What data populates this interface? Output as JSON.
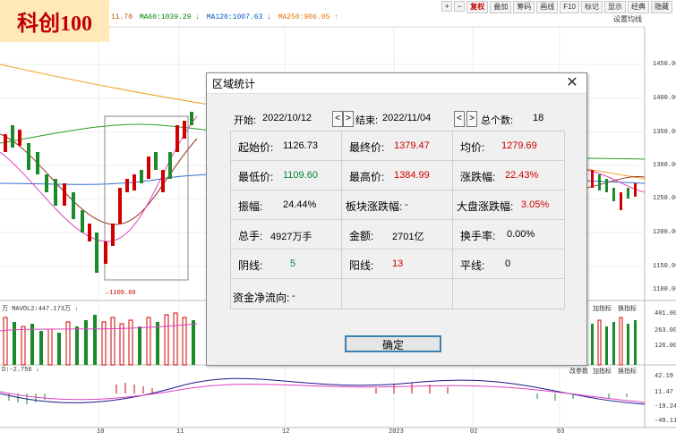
{
  "logo": {
    "text": "科创100"
  },
  "ma_legend": [
    {
      "text": "11.70",
      "color": "#b05000"
    },
    {
      "text": "MA60:1039.29 ↓",
      "color": "#008000"
    },
    {
      "text": "MA120:1007.63 ↓",
      "color": "#0050c0"
    },
    {
      "text": "MA250:906.05 ↑",
      "color": "#e07000"
    }
  ],
  "toolbar": {
    "plus": "+",
    "minus": "−",
    "b1": "复权",
    "b2": "叠加",
    "b3": "筹码",
    "b4": "画线",
    "b5": "F10",
    "b6": "标记",
    "b7": "显示",
    "b8": "经典",
    "b9": "隐藏"
  },
  "settings_link": "设置均线",
  "price_axis": [
    "1450.00",
    "1400.00",
    "1350.00",
    "1300.00",
    "1250.00",
    "1200.00",
    "1150.00",
    "1100.00"
  ],
  "low_marker": "←1109.60",
  "vol_label": "万  MAVOL2:447.173万 ↓",
  "vol_axis": [
    "401.00",
    "263.00",
    "126.00"
  ],
  "vol_buttons": {
    "a": "加指标",
    "b": "换指标"
  },
  "macd_label": "D:-2.756 ↓",
  "macd_axis": [
    "42.19",
    "11.47",
    "-19.24",
    "-49.11"
  ],
  "macd_buttons": {
    "a": "改参数",
    "b": "加指标",
    "c": "换指标"
  },
  "x_axis": [
    "10",
    "11",
    "12",
    "2023",
    "02",
    "03"
  ],
  "dialog": {
    "title": "区域统计",
    "close": "✕",
    "start_label": "开始:",
    "start_date": "2022/10/12",
    "end_label": "结束:",
    "end_date": "2022/11/04",
    "prev": "<",
    "next": ">",
    "count_label": "总个数:",
    "count_value": "18",
    "stats": {
      "open_label": "起始价:",
      "open_value": "1126.73",
      "close_label": "最终价:",
      "close_value": "1379.47",
      "avg_label": "均价:",
      "avg_value": "1279.69",
      "low_label": "最低价:",
      "low_value": "1109.60",
      "high_label": "最高价:",
      "high_value": "1384.99",
      "chg_label": "涨跌幅:",
      "chg_value": "22.43%",
      "amp_label": "振幅:",
      "amp_value": "24.44%",
      "sector_label": "板块涨跌幅:",
      "sector_value": "-",
      "market_label": "大盘涨跌幅:",
      "market_value": "3.05%",
      "vol_label": "总手:",
      "vol_value": "4927万手",
      "amt_label": "金额:",
      "amt_value": "2701亿",
      "turn_label": "换手率:",
      "turn_value": "0.00%",
      "neg_label": "阴线:",
      "neg_value": "5",
      "pos_label": "阳线:",
      "pos_value": "13",
      "flat_label": "平线:",
      "flat_value": "0",
      "flow_label": "资金净流向:",
      "flow_value": "-"
    },
    "ok": "确定"
  }
}
